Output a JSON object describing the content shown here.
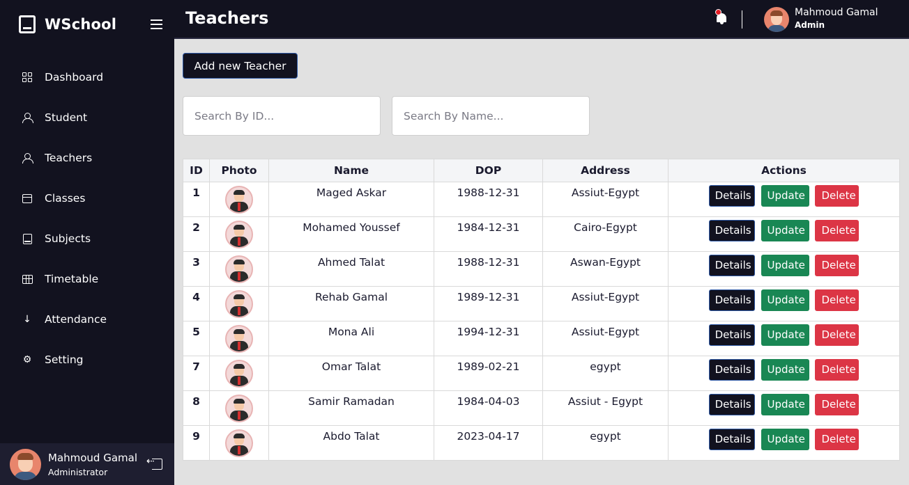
{
  "app": {
    "brand": "WSchool"
  },
  "sidebar": {
    "items": [
      {
        "label": "Dashboard",
        "icon": "dashboard-icon"
      },
      {
        "label": "Student",
        "icon": "user-icon"
      },
      {
        "label": "Teachers",
        "icon": "teacher-icon"
      },
      {
        "label": "Classes",
        "icon": "archive-icon"
      },
      {
        "label": "Subjects",
        "icon": "book-icon"
      },
      {
        "label": "Timetable",
        "icon": "table-icon"
      },
      {
        "label": "Attendance",
        "icon": "arrow-down-icon"
      },
      {
        "label": "Setting",
        "icon": "gear-icon"
      }
    ],
    "footer": {
      "name": "Mahmoud Gamal",
      "role": "Administrator"
    }
  },
  "header": {
    "title": "Teachers",
    "user": {
      "name": "Mahmoud Gamal",
      "role": "Admin"
    }
  },
  "main": {
    "add_button": "Add new Teacher",
    "search_id_placeholder": "Search By ID...",
    "search_name_placeholder": "Search By Name...",
    "columns": [
      "ID",
      "Photo",
      "Name",
      "DOP",
      "Address",
      "Actions"
    ],
    "actions": {
      "details": "Details",
      "update": "Update",
      "delete": "Delete"
    },
    "rows": [
      {
        "id": "1",
        "name": "Maged Askar",
        "dop": "1988-12-31",
        "address": "Assiut-Egypt"
      },
      {
        "id": "2",
        "name": "Mohamed Youssef",
        "dop": "1984-12-31",
        "address": "Cairo-Egypt"
      },
      {
        "id": "3",
        "name": "Ahmed Talat",
        "dop": "1988-12-31",
        "address": "Aswan-Egypt"
      },
      {
        "id": "4",
        "name": "Rehab Gamal",
        "dop": "1989-12-31",
        "address": "Assiut-Egypt"
      },
      {
        "id": "5",
        "name": "Mona Ali",
        "dop": "1994-12-31",
        "address": "Assiut-Egypt"
      },
      {
        "id": "7",
        "name": "Omar Talat",
        "dop": "1989-02-21",
        "address": "egypt"
      },
      {
        "id": "8",
        "name": "Samir Ramadan",
        "dop": "1984-04-03",
        "address": "Assiut - Egypt"
      },
      {
        "id": "9",
        "name": "Abdo Talat",
        "dop": "2023-04-17",
        "address": "egypt"
      }
    ]
  },
  "colors": {
    "sidebar_bg": "#12121f",
    "content_bg": "#e1e1e1",
    "update": "#198754",
    "delete": "#dc3545",
    "notification_dot": "#e31b23"
  }
}
